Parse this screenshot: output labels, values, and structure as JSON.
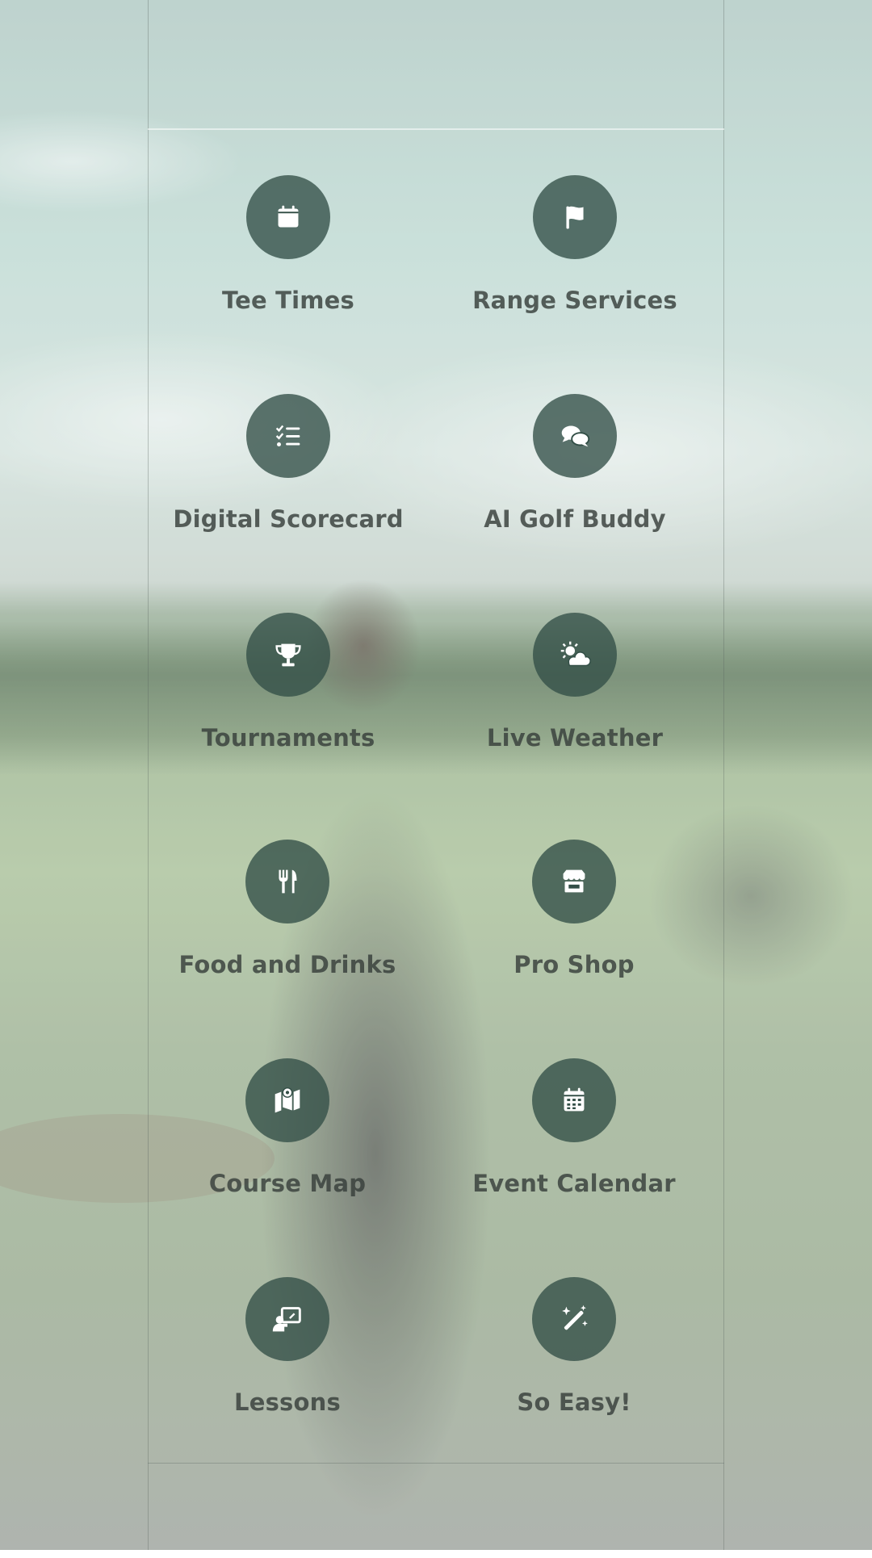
{
  "colors": {
    "icon_circle": "#324e46",
    "label_text": "#373e3a",
    "icon_glyph": "#ffffff"
  },
  "menu": {
    "items": [
      {
        "label": "Tee Times",
        "icon": "calendar-icon"
      },
      {
        "label": "Range Services",
        "icon": "flag-icon"
      },
      {
        "label": "Digital Scorecard",
        "icon": "checklist-icon"
      },
      {
        "label": "AI Golf Buddy",
        "icon": "chat-bubbles-icon"
      },
      {
        "label": "Tournaments",
        "icon": "trophy-icon"
      },
      {
        "label": "Live Weather",
        "icon": "sun-cloud-icon"
      },
      {
        "label": "Food and Drinks",
        "icon": "utensils-icon"
      },
      {
        "label": "Pro Shop",
        "icon": "store-icon"
      },
      {
        "label": "Course Map",
        "icon": "map-icon"
      },
      {
        "label": "Event Calendar",
        "icon": "calendar-grid-icon"
      },
      {
        "label": "Lessons",
        "icon": "presentation-icon"
      },
      {
        "label": "So Easy!",
        "icon": "magic-wand-icon"
      }
    ]
  }
}
